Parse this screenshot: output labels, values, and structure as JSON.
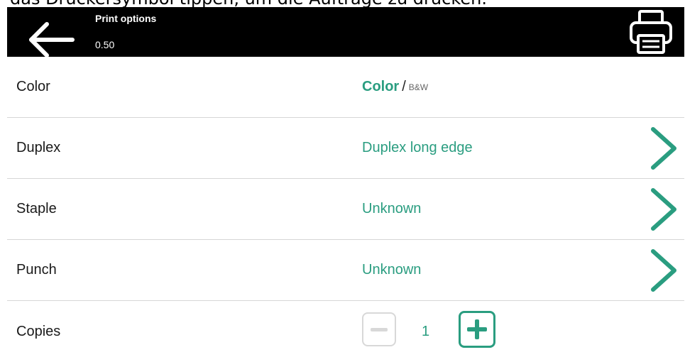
{
  "page_caption": "das Druckersymbol tippen, um die Aufträge zu drucken.",
  "header": {
    "title": "Print options",
    "subtitle": "0.50"
  },
  "icons": {
    "back": "arrow-left-icon",
    "print": "printer-icon",
    "chevron": "chevron-right-icon"
  },
  "colors": {
    "accent": "#2a9d80",
    "header_bg": "#000000",
    "divider": "#d6d6d6"
  },
  "options": {
    "color": {
      "label": "Color",
      "selected": "Color",
      "separator": "/",
      "alternative": "B&W"
    },
    "duplex": {
      "label": "Duplex",
      "value": "Duplex long edge"
    },
    "staple": {
      "label": "Staple",
      "value": "Unknown"
    },
    "punch": {
      "label": "Punch",
      "value": "Unknown"
    },
    "copies": {
      "label": "Copies",
      "value": "1"
    }
  }
}
